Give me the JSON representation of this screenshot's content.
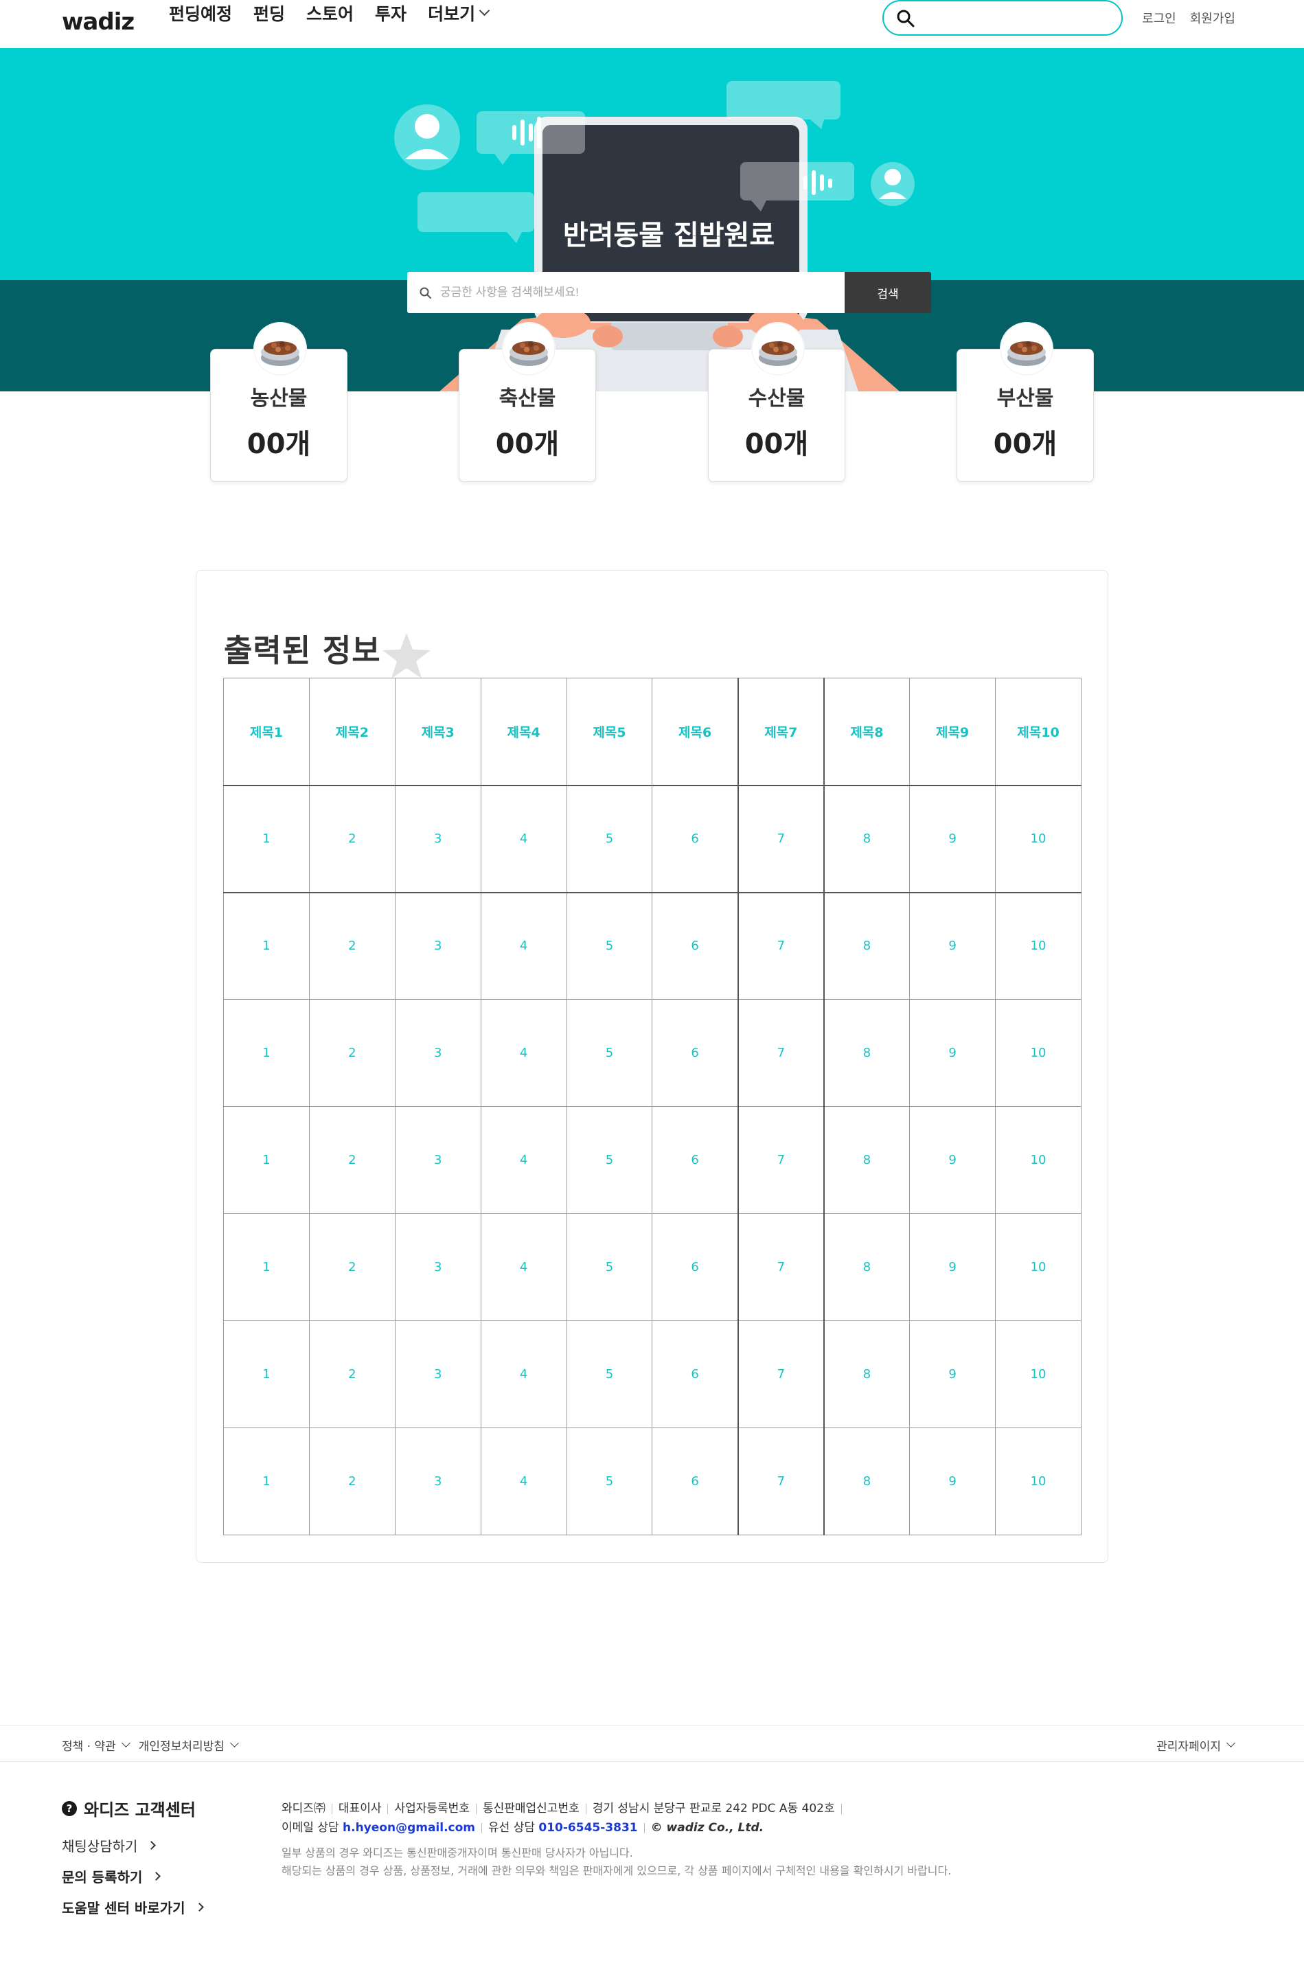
{
  "header": {
    "logo": "wadiz",
    "nav": [
      {
        "label": "펀딩예정"
      },
      {
        "label": "펀딩"
      },
      {
        "label": "스토어"
      },
      {
        "label": "투자"
      },
      {
        "label": "더보기"
      }
    ],
    "search_value": "",
    "login": "로그인",
    "signup": "회원가입"
  },
  "hero": {
    "title": "반려동물 집밥원료",
    "search_placeholder": "궁금한 사항을 검색해보세요!",
    "search_button": "검색"
  },
  "categories": [
    {
      "name": "농산물",
      "count": "00개"
    },
    {
      "name": "축산물",
      "count": "00개"
    },
    {
      "name": "수산물",
      "count": "00개"
    },
    {
      "name": "부산물",
      "count": "00개"
    }
  ],
  "panel": {
    "title": "출력된 정보",
    "columns": [
      "제목1",
      "제목2",
      "제목3",
      "제목4",
      "제목5",
      "제목6",
      "제목7",
      "제목8",
      "제목9",
      "제목10"
    ],
    "rows": [
      [
        "1",
        "2",
        "3",
        "4",
        "5",
        "6",
        "7",
        "8",
        "9",
        "10"
      ],
      [
        "1",
        "2",
        "3",
        "4",
        "5",
        "6",
        "7",
        "8",
        "9",
        "10"
      ],
      [
        "1",
        "2",
        "3",
        "4",
        "5",
        "6",
        "7",
        "8",
        "9",
        "10"
      ],
      [
        "1",
        "2",
        "3",
        "4",
        "5",
        "6",
        "7",
        "8",
        "9",
        "10"
      ],
      [
        "1",
        "2",
        "3",
        "4",
        "5",
        "6",
        "7",
        "8",
        "9",
        "10"
      ],
      [
        "1",
        "2",
        "3",
        "4",
        "5",
        "6",
        "7",
        "8",
        "9",
        "10"
      ],
      [
        "1",
        "2",
        "3",
        "4",
        "5",
        "6",
        "7",
        "8",
        "9",
        "10"
      ]
    ]
  },
  "footer": {
    "policy": "정책 · 약관",
    "privacy": "개인정보처리방침",
    "admin": "관리자페이지",
    "cs_title": "와디즈 고객센터",
    "cs_links": [
      "채팅상담하기",
      "문의 등록하기",
      "도움말 센터 바로가기"
    ],
    "company_row1": [
      "와디즈㈜",
      "대표이사",
      "사업자등록번호",
      "통신판매업신고번호",
      "경기 성남시 분당구 판교로 242 PDC A동 402호"
    ],
    "email_label": "이메일 상담",
    "email": "h.hyeon@gmail.com",
    "phone_label": "유선 상담",
    "phone": "010-6545-3831",
    "copyright": "© wadiz Co., Ltd.",
    "notice1": "일부 상품의 경우 와디즈는 통신판매중개자이며 통신판매 당사자가 아닙니다.",
    "notice2": "해당되는 상품의 경우 상품, 상품정보, 거래에 관한 의무와 책임은 판매자에게 있으므로, 각 상품 페이지에서 구체적인 내용을 확인하시기 바랍니다."
  },
  "colors": {
    "accent": "#00c4c4",
    "hero_top": "#02cfcf",
    "hero_bottom": "#036166",
    "table_text": "#19c2c2"
  }
}
